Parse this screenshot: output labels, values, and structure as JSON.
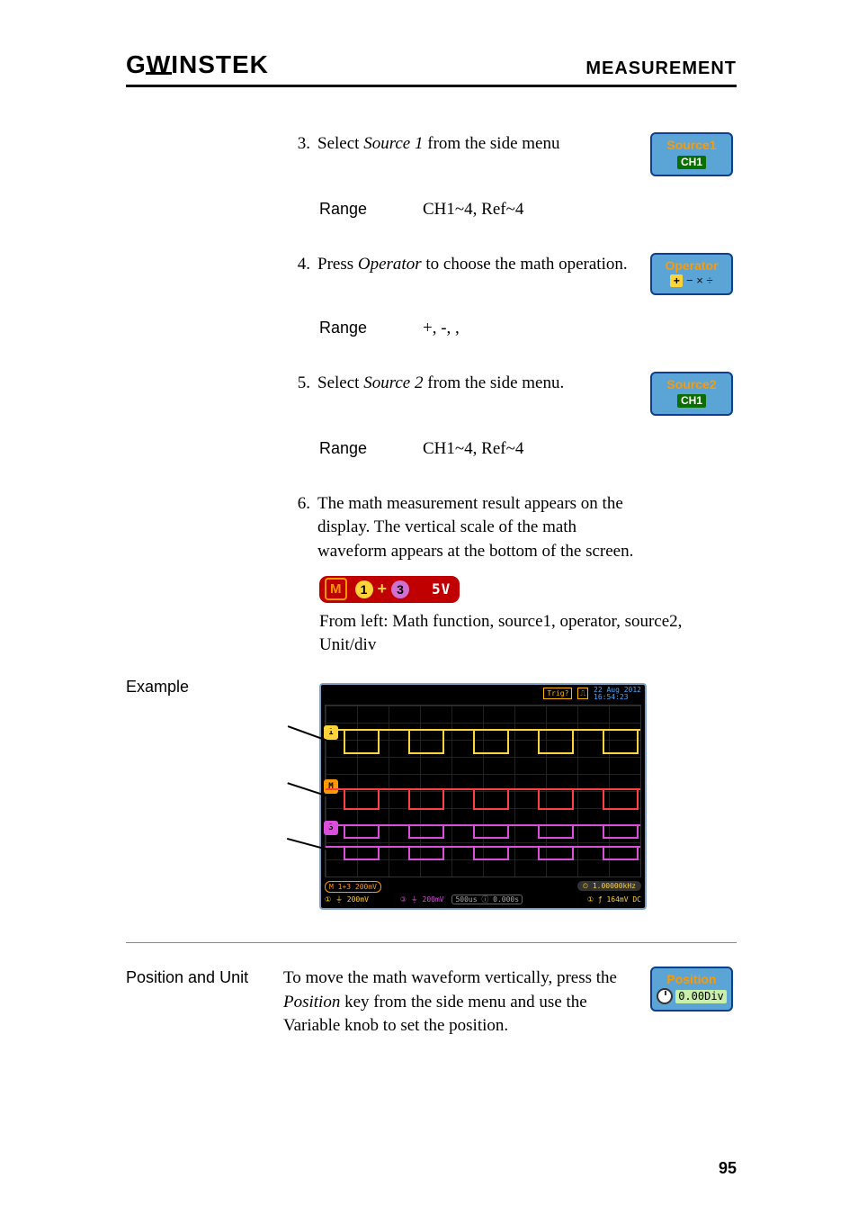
{
  "header": {
    "brand_prefix": "G",
    "brand_u": "W",
    "brand_rest": "INSTEK",
    "section": "MEASUREMENT"
  },
  "steps": {
    "s3": {
      "num": "3.",
      "text_a": "Select ",
      "text_i": "Source 1",
      "text_b": " from the side menu",
      "btn_title": "Source1",
      "btn_value": "CH1",
      "range_label": "Range",
      "range_value": "CH1~4, Ref~4"
    },
    "s4": {
      "num": "4.",
      "text_a": "Press ",
      "text_i": "Operator",
      "text_b": " to choose the math operation.",
      "btn_title": "Operator",
      "btn_ops": "−  ×  ÷",
      "btn_op_hl": "+",
      "range_label": "Range",
      "range_value": "+, -,  ,"
    },
    "s5": {
      "num": "5.",
      "text_a": "Select ",
      "text_i": "Source 2",
      "text_b": " from the side menu.",
      "btn_title": "Source2",
      "btn_value": "CH1",
      "range_label": "Range",
      "range_value": "CH1~4, Ref~4"
    },
    "s6": {
      "num": "6.",
      "text": "The math measurement result appears on the display. The vertical scale of the math waveform appears at the bottom of the screen.",
      "strip": {
        "m": "M",
        "c1": "1",
        "op": "+",
        "c3": "3",
        "val": "5V"
      },
      "caption": "From left: Math function, source1, operator, source2,  Unit/div"
    }
  },
  "example": {
    "label": "Example",
    "scope": {
      "trig_tag": "Trig?",
      "date_l1": "22 Aug 2012",
      "date_l2": "16:54:23",
      "bb1": "M 1+3  200mV",
      "bbtrg": "⏲ 1.00000kHz",
      "chline_ch1": "① ⏚ 200mV",
      "chline_ch3": "③ ⏚ 200mV",
      "chline_time": "500us ⓘ 0.000s",
      "chline_trg": "① ƒ  164mV   DC",
      "cm1": "1",
      "cmM": "M",
      "cm3": "3"
    }
  },
  "position": {
    "label": "Position and Unit",
    "text_a": "To move the math waveform vertically, press the ",
    "text_i": "Position",
    "text_b": " key from the side menu and use the Variable knob to set the position.",
    "btn_title": "Position",
    "btn_value": "0.00Div"
  },
  "page_number": "95"
}
